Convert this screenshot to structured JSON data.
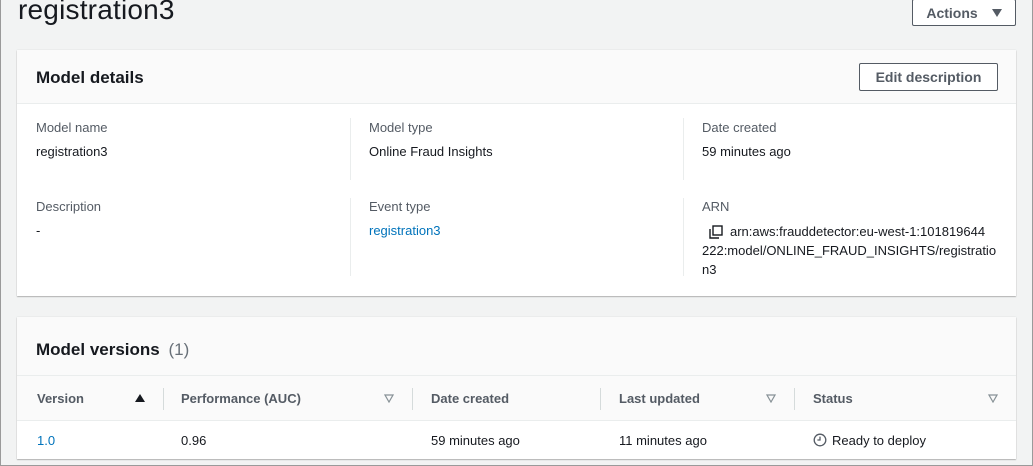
{
  "page": {
    "title": "registration3",
    "actions_label": "Actions"
  },
  "model_details": {
    "title": "Model details",
    "edit_label": "Edit description",
    "fields": {
      "model_name": {
        "label": "Model name",
        "value": "registration3"
      },
      "model_type": {
        "label": "Model type",
        "value": "Online Fraud Insights"
      },
      "date_created": {
        "label": "Date created",
        "value": "59 minutes ago"
      },
      "description": {
        "label": "Description",
        "value": "-"
      },
      "event_type": {
        "label": "Event type",
        "value": "registration3"
      },
      "arn": {
        "label": "ARN",
        "line1": "arn:aws:frauddetector:eu-west-1:101819644",
        "line2": "222:model/ONLINE_FRAUD_INSIGHTS/registratio",
        "line3": "n3"
      }
    }
  },
  "model_versions": {
    "title": "Model versions",
    "count": "(1)",
    "columns": {
      "version": "Version",
      "performance": "Performance (AUC)",
      "date_created": "Date created",
      "last_updated": "Last updated",
      "status": "Status"
    },
    "rows": [
      {
        "version": "1.0",
        "performance": "0.96",
        "date_created": "59 minutes ago",
        "last_updated": "11 minutes ago",
        "status": "Ready to deploy"
      }
    ]
  },
  "icons": {
    "actions_caret": "caret-down-icon",
    "sort_ascending": "sort-ascending-icon",
    "sort_neutral": "sort-neutral-icon",
    "copy": "copy-icon",
    "status": "status-clock-icon"
  },
  "colors": {
    "link": "#0073bb",
    "text": "#16191f",
    "label": "#545b64",
    "background": "#f2f3f3"
  }
}
